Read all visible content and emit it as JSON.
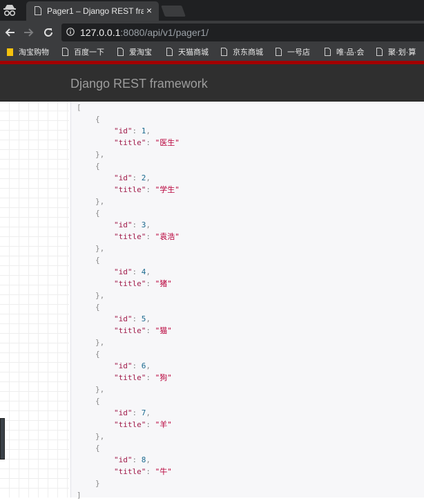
{
  "browser": {
    "tab_title": "Pager1 – Django REST fram",
    "tab_close": "×",
    "url_host": "127.0.0.1",
    "url_rest": ":8080/api/v1/pager1/",
    "bookmarks": [
      "淘宝购物",
      "百度一下",
      "爱淘宝",
      "天猫商城",
      "京东商城",
      "一号店",
      "唯·品·会",
      "聚·划·算"
    ]
  },
  "app": {
    "brand": "Django REST framework"
  },
  "response": {
    "open": "[",
    "close": "]",
    "items": [
      {
        "id": "1",
        "title": "医生"
      },
      {
        "id": "2",
        "title": "学生"
      },
      {
        "id": "3",
        "title": "袁浩"
      },
      {
        "id": "4",
        "title": "猪"
      },
      {
        "id": "5",
        "title": "猫"
      },
      {
        "id": "6",
        "title": "狗"
      },
      {
        "id": "7",
        "title": "羊"
      },
      {
        "id": "8",
        "title": "牛"
      }
    ]
  },
  "colors": {
    "navbar": "#2f2f2f",
    "accent_strip": "#a30000",
    "json_key": "#a01b4a",
    "json_number": "#1b6a8f",
    "json_string": "#b8003a"
  },
  "icons": [
    "incognito-icon",
    "page-icon",
    "close-icon",
    "back-arrow-icon",
    "forward-arrow-icon",
    "reload-icon",
    "info-icon",
    "bookmark-folder-icon",
    "page-icon"
  ]
}
